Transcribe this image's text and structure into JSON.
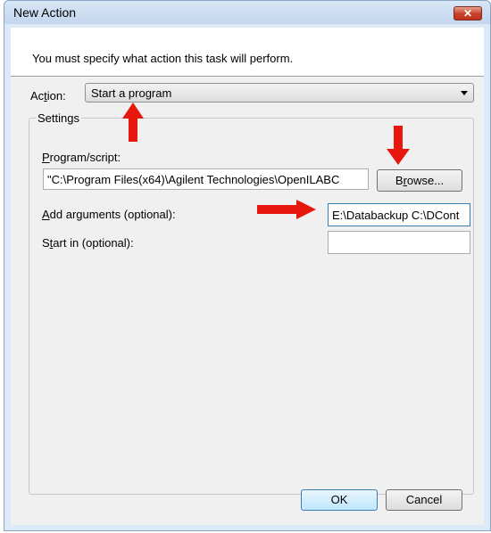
{
  "window": {
    "title": "New Action",
    "close_glyph": "✕"
  },
  "instruction": "You must specify what action this task will perform.",
  "action": {
    "label_prefix": "Ac",
    "label_underline": "t",
    "label_suffix": "ion:",
    "selected": "Start a program"
  },
  "settings": {
    "legend": "Settings",
    "program": {
      "label_underline": "P",
      "label_rest": "rogram/script:",
      "value": "\"C:\\Program Files(x64)\\Agilent Technologies\\OpenILABC"
    },
    "browse": {
      "label_prefix": "B",
      "label_underline": "r",
      "label_suffix": "owse..."
    },
    "arguments": {
      "label_underline": "A",
      "label_rest": "dd arguments (optional):",
      "value": "E:\\Databackup C:\\DCont"
    },
    "start_in": {
      "label_prefix": "S",
      "label_underline": "t",
      "label_suffix": "art in (optional):",
      "value": ""
    }
  },
  "buttons": {
    "ok": "OK",
    "cancel": "Cancel"
  },
  "annotations": {
    "arrow_color": "#e8170d"
  }
}
